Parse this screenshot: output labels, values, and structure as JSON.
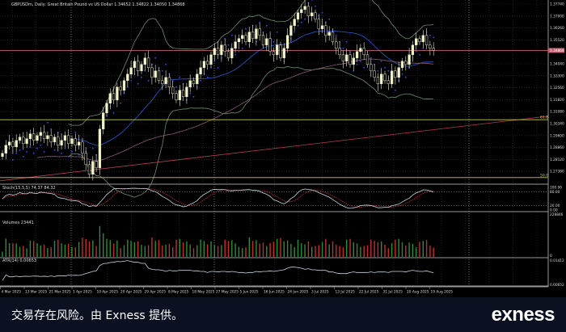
{
  "chart_data": {
    "type": "candlestick",
    "title": "GBPUSDm, Daily: Great Britain Pound vs US Dollar 1.34652 1.34822 1.34050 1.34868",
    "current_price": "1.34868",
    "price_ticks": [
      "1.37740",
      "1.37000",
      "1.36260",
      "1.35520",
      "1.34040",
      "1.33300",
      "1.32560",
      "1.31820",
      "1.31080",
      "1.30340",
      "1.29600",
      "1.28860",
      "1.28120",
      "1.27380"
    ],
    "fib_levels": [
      {
        "label": "61.8",
        "price": 1.3058
      },
      {
        "label": "50.0",
        "price": 1.27
      }
    ],
    "long_ma": [
      1.272,
      1.308
    ],
    "date_labels": [
      "4 Mar 2025",
      "13 Mar 2025",
      "21 Mar 2025",
      "1 Apr 2025",
      "10 Apr 2025",
      "20 Apr 2025",
      "29 Apr 2025",
      "8 May 2025",
      "18 May 2025",
      "27 May 2025",
      "5 Jun 2025",
      "16 Jun 2025",
      "24 Jun 2025",
      "3 Jul 2025",
      "13 Jul 2025",
      "22 Jul 2025",
      "31 Jul 2025",
      "10 Aug 2025",
      "19 Aug 2025"
    ],
    "closes": [
      1.285,
      1.29,
      1.292,
      1.289,
      1.293,
      1.295,
      1.291,
      1.294,
      1.297,
      1.293,
      1.296,
      1.298,
      1.294,
      1.296,
      1.292,
      1.295,
      1.29,
      1.293,
      1.296,
      1.291,
      1.294,
      1.29,
      1.292,
      1.285,
      1.278,
      1.272,
      1.28,
      1.276,
      1.3,
      1.31,
      1.316,
      1.322,
      1.318,
      1.326,
      1.324,
      1.33,
      1.334,
      1.338,
      1.342,
      1.336,
      1.34,
      1.344,
      1.338,
      1.332,
      1.336,
      1.33,
      1.328,
      1.332,
      1.326,
      1.322,
      1.318,
      1.324,
      1.32,
      1.326,
      1.33,
      1.328,
      1.334,
      1.338,
      1.342,
      1.34,
      1.346,
      1.35,
      1.346,
      1.352,
      1.348,
      1.344,
      1.35,
      1.354,
      1.356,
      1.358,
      1.354,
      1.36,
      1.356,
      1.362,
      1.358,
      1.352,
      1.356,
      1.348,
      1.346,
      1.352,
      1.344,
      1.35,
      1.358,
      1.364,
      1.368,
      1.372,
      1.374,
      1.376,
      1.37,
      1.372,
      1.368,
      1.362,
      1.364,
      1.358,
      1.36,
      1.354,
      1.35,
      1.346,
      1.342,
      1.346,
      1.34,
      1.344,
      1.348,
      1.35,
      1.346,
      1.34,
      1.336,
      1.332,
      1.328,
      1.334,
      1.33,
      1.328,
      1.336,
      1.332,
      1.338,
      1.342,
      1.34,
      1.346,
      1.352,
      1.356,
      1.354,
      1.358,
      1.352,
      1.35,
      1.3487
    ],
    "stoch": {
      "label": "Stoch(15,5,5) 74.37 84.32",
      "levels": [
        "100.00",
        "80.00",
        "20.00",
        "0.00"
      ]
    },
    "volumes": {
      "label": "Volumes 23441",
      "levels": [
        "228846",
        "0"
      ]
    },
    "atr": {
      "label": "ATR(14) 0.00653",
      "levels": [
        "0.01412",
        "0.00652"
      ]
    }
  },
  "footer": {
    "disclaimer": "交易存在风险。由 Exness 提供。",
    "logo": "exness"
  }
}
